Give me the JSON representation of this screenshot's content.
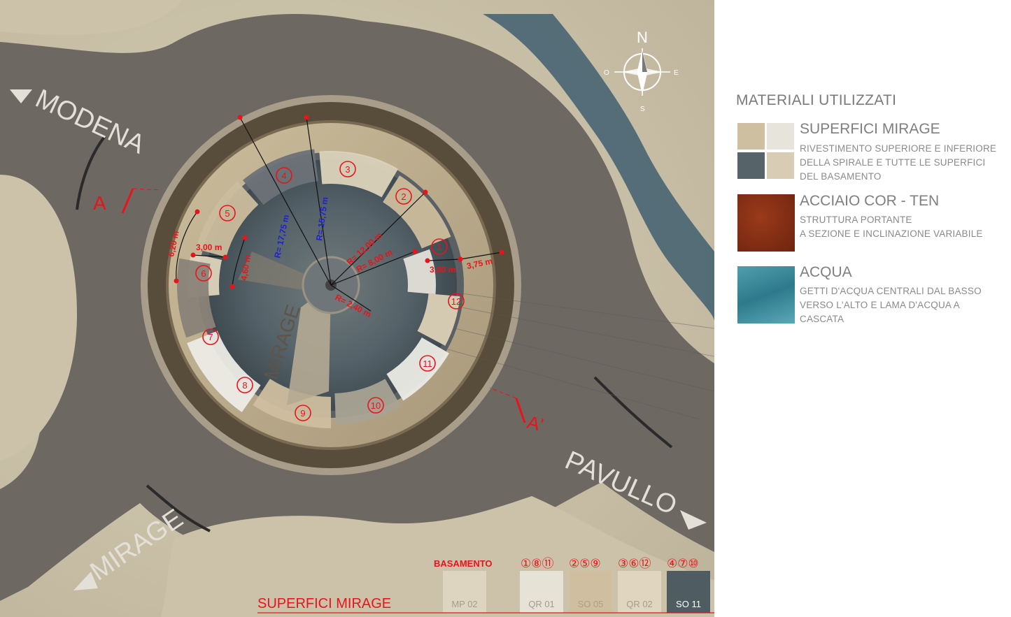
{
  "compass": {
    "n": "N",
    "e": "E",
    "s": "S",
    "o": "O"
  },
  "roads": {
    "modena": "MODENA",
    "pavullo": "PAVULLO",
    "mirage": "MIRAGE"
  },
  "section_marks": {
    "a": "A",
    "a_prime": "A'"
  },
  "center_text": "MIRAGE",
  "segments": [
    "1",
    "2",
    "3",
    "4",
    "5",
    "6",
    "7",
    "8",
    "9",
    "10",
    "11",
    "12"
  ],
  "dimensions": {
    "r_outer": "R= 17,75 m",
    "r_mid": "R= 15,75 m",
    "r_12": "R= 12,00 m",
    "r_8": "R= 8,00 m",
    "r_2": "R= 2,40 m",
    "d_620": "6,20 m",
    "d_300_left": "3,00 m",
    "d_460": "4,60 m",
    "d_300_right": "3,00 m",
    "d_375": "3,75 m"
  },
  "bottom_legend": {
    "basamento": "BASAMENTO",
    "group1": "①⑧⑪",
    "group2": "②⑤⑨",
    "group3": "③⑥⑫",
    "group4": "④⑦⑩",
    "swatches": [
      "MP 02",
      "QR 01",
      "SO 05",
      "QR 02",
      "SO 11"
    ],
    "title": "SUPERFICI MIRAGE"
  },
  "legend": {
    "title": "MATERIALI UTILIZZATI",
    "items": [
      {
        "heading": "SUPERFICI MIRAGE",
        "lines": [
          "RIVESTIMENTO SUPERIORE E INFERIORE",
          "DELLA SPIRALE E TUTTE LE SUPERFICI",
          "DEL BASAMENTO"
        ]
      },
      {
        "heading": "ACCIAIO COR - TEN",
        "lines": [
          "STRUTTURA PORTANTE",
          "A SEZIONE E INCLINAZIONE  VARIABILE"
        ]
      },
      {
        "heading": "ACQUA",
        "lines": [
          "GETTI D'ACQUA CENTRALI DAL BASSO",
          "VERSO L'ALTO E LAMA D'ACQUA A",
          "CASCATA"
        ]
      }
    ]
  },
  "colors": {
    "annotation_red": "#e8141b",
    "radius_blue": "#1f1fd9",
    "road": "#6e6862",
    "ground": "#cfc6ae",
    "water": "#3f5f70"
  }
}
